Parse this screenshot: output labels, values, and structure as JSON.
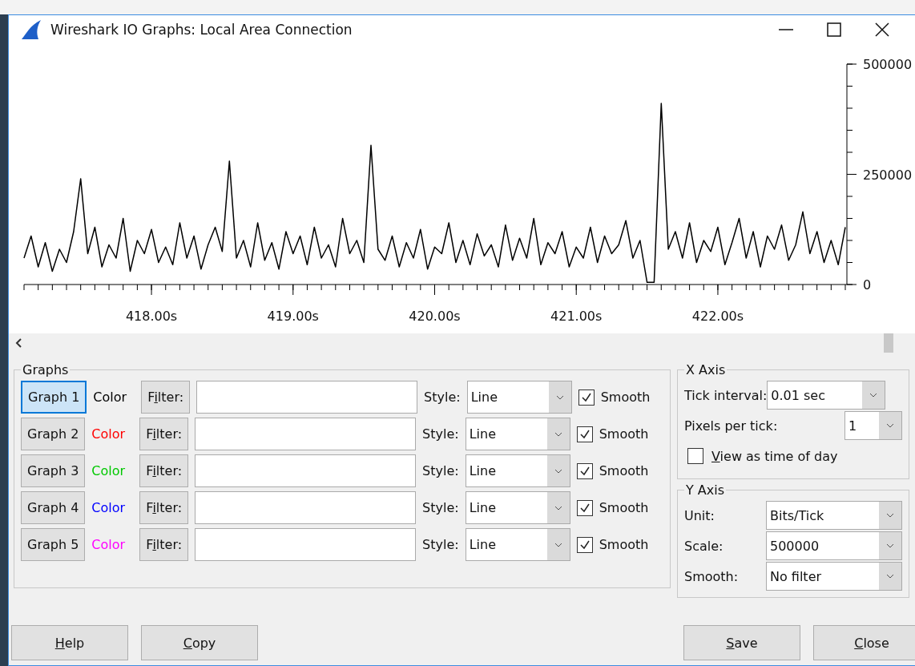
{
  "window": {
    "title": "Wireshark IO Graphs: Local Area Connection"
  },
  "chart": {
    "chart_data": {
      "type": "line",
      "xlim": [
        417.1,
        422.9
      ],
      "ylim": [
        0,
        500000
      ],
      "xticks": [
        {
          "value": 418,
          "label": "418.00s"
        },
        {
          "value": 419,
          "label": "419.00s"
        },
        {
          "value": 420,
          "label": "420.00s"
        },
        {
          "value": 421,
          "label": "421.00s"
        },
        {
          "value": 422,
          "label": "422.00s"
        }
      ],
      "yticks": [
        {
          "value": 0,
          "label": "0"
        },
        {
          "value": 250000,
          "label": "250000"
        },
        {
          "value": 500000,
          "label": "500000"
        }
      ],
      "x": [
        417.1,
        417.15,
        417.2,
        417.25,
        417.3,
        417.35,
        417.4,
        417.45,
        417.5,
        417.55,
        417.6,
        417.65,
        417.7,
        417.75,
        417.8,
        417.85,
        417.9,
        417.95,
        418.0,
        418.05,
        418.1,
        418.15,
        418.2,
        418.25,
        418.3,
        418.35,
        418.4,
        418.45,
        418.5,
        418.55,
        418.6,
        418.65,
        418.7,
        418.75,
        418.8,
        418.85,
        418.9,
        418.95,
        419.0,
        419.05,
        419.1,
        419.15,
        419.2,
        419.25,
        419.3,
        419.35,
        419.4,
        419.45,
        419.5,
        419.55,
        419.6,
        419.65,
        419.7,
        419.75,
        419.8,
        419.85,
        419.9,
        419.95,
        420.0,
        420.05,
        420.1,
        420.15,
        420.2,
        420.25,
        420.3,
        420.35,
        420.4,
        420.45,
        420.5,
        420.55,
        420.6,
        420.65,
        420.7,
        420.75,
        420.8,
        420.85,
        420.9,
        420.95,
        421.0,
        421.05,
        421.1,
        421.15,
        421.2,
        421.25,
        421.3,
        421.35,
        421.4,
        421.45,
        421.5,
        421.55,
        421.6,
        421.65,
        421.7,
        421.75,
        421.8,
        421.85,
        421.9,
        421.95,
        422.0,
        422.05,
        422.1,
        422.15,
        422.2,
        422.25,
        422.3,
        422.35,
        422.4,
        422.45,
        422.5,
        422.55,
        422.6,
        422.65,
        422.7,
        422.75,
        422.8,
        422.85,
        422.9
      ],
      "series": [
        {
          "color": "#000000",
          "values": [
            60000,
            110000,
            40000,
            95000,
            30000,
            80000,
            50000,
            120000,
            240000,
            70000,
            130000,
            40000,
            90000,
            60000,
            150000,
            30000,
            100000,
            70000,
            125000,
            50000,
            85000,
            45000,
            140000,
            60000,
            110000,
            35000,
            90000,
            130000,
            75000,
            280000,
            60000,
            100000,
            40000,
            140000,
            55000,
            95000,
            35000,
            120000,
            70000,
            110000,
            45000,
            130000,
            60000,
            90000,
            40000,
            150000,
            70000,
            100000,
            50000,
            316000,
            80000,
            55000,
            110000,
            40000,
            95000,
            60000,
            125000,
            35000,
            85000,
            70000,
            140000,
            50000,
            100000,
            45000,
            115000,
            65000,
            90000,
            40000,
            135000,
            55000,
            105000,
            60000,
            150000,
            45000,
            95000,
            70000,
            120000,
            40000,
            85000,
            60000,
            130000,
            50000,
            110000,
            70000,
            90000,
            145000,
            60000,
            100000,
            5000,
            5000,
            411000,
            80000,
            120000,
            60000,
            140000,
            50000,
            100000,
            75000,
            130000,
            45000,
            95000,
            150000,
            60000,
            120000,
            40000,
            110000,
            80000,
            135000,
            55000,
            90000,
            165000,
            70000,
            120000,
            50000,
            100000,
            45000,
            130000
          ]
        }
      ]
    }
  },
  "graphs": {
    "title": "Graphs",
    "rows": [
      {
        "name": "Graph 1",
        "selected": true,
        "color_label": "Color",
        "color": "#000000",
        "filter_button": "Filter:",
        "style_label": "Style:",
        "style": "Line",
        "smooth_label": "Smooth",
        "smooth": true
      },
      {
        "name": "Graph 2",
        "selected": false,
        "color_label": "Color",
        "color": "#ff0000",
        "filter_button": "Filter:",
        "style_label": "Style:",
        "style": "Line",
        "smooth_label": "Smooth",
        "smooth": true
      },
      {
        "name": "Graph 3",
        "selected": false,
        "color_label": "Color",
        "color": "#00c800",
        "filter_button": "Filter:",
        "style_label": "Style:",
        "style": "Line",
        "smooth_label": "Smooth",
        "smooth": true
      },
      {
        "name": "Graph 4",
        "selected": false,
        "color_label": "Color",
        "color": "#0000ff",
        "filter_button": "Filter:",
        "style_label": "Style:",
        "style": "Line",
        "smooth_label": "Smooth",
        "smooth": true
      },
      {
        "name": "Graph 5",
        "selected": false,
        "color_label": "Color",
        "color": "#ff00ff",
        "filter_button": "Filter:",
        "style_label": "Style:",
        "style": "Line",
        "smooth_label": "Smooth",
        "smooth": true
      }
    ]
  },
  "x_axis": {
    "title": "X Axis",
    "tick_interval": {
      "label": "Tick interval:",
      "value": "0.01 sec"
    },
    "pixels_per_tick": {
      "label": "Pixels per tick:",
      "value": "1"
    },
    "time_of_day": {
      "label": "View as time of day",
      "checked": false
    }
  },
  "y_axis": {
    "title": "Y Axis",
    "fields": [
      {
        "label": "Unit:",
        "value": "Bits/Tick"
      },
      {
        "label": "Scale:",
        "value": "500000"
      },
      {
        "label": "Smooth:",
        "value": "No filter"
      }
    ]
  },
  "left_buttons": [
    {
      "label": "Help"
    },
    {
      "label": "Copy"
    }
  ],
  "right_buttons": [
    {
      "label": "Save"
    },
    {
      "label": "Close"
    }
  ]
}
